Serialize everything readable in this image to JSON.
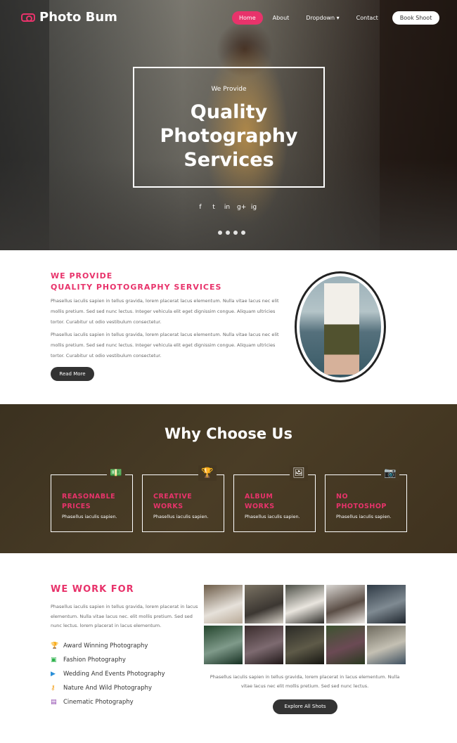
{
  "header": {
    "logo": "Photo Bum",
    "nav": [
      "Home",
      "About",
      "Dropdown ▾",
      "Contact"
    ],
    "book": "Book Shoot"
  },
  "hero": {
    "pre": "We Provide",
    "line1": "Quality",
    "line2": "Photography",
    "line3": "Services",
    "social": [
      "f",
      "t",
      "in",
      "g+",
      "ig"
    ]
  },
  "provide": {
    "title1": "WE PROVIDE",
    "title2": "QUALITY PHOTOGRAPHY SERVICES",
    "p1": "Phasellus iaculis sapien in tellus gravida, lorem placerat lacus elementum. Nulla vitae lacus nec elit mollis pretium. Sed sed nunc lectus. Integer vehicula elit eget dignissim congue. Aliquam ultricies tortor. Curabitur ut odio vestibulum consectetur.",
    "p2": "Phasellus iaculis sapien in tellus gravida, lorem placerat lacus elementum. Nulla vitae lacus nec elit mollis pretium. Sed sed nunc lectus. Integer vehicula elit eget dignissim congue. Aliquam ultricies tortor. Curabitur ut odio vestibulum consectetur.",
    "button": "Read More"
  },
  "why": {
    "title": "Why Choose Us",
    "cards": [
      {
        "t1": "REASONABLE",
        "t2": "PRICES",
        "d": "Phasellus iaculis sapien.",
        "icon": "💵"
      },
      {
        "t1": "CREATIVE",
        "t2": "WORKS",
        "d": "Phasellus iaculis sapien.",
        "icon": "🏆"
      },
      {
        "t1": "ALBUM",
        "t2": "WORKS",
        "d": "Phasellus iaculis sapien.",
        "icon": "🖼"
      },
      {
        "t1": "NO",
        "t2": "PHOTOSHOP",
        "d": "Phasellus iaculis sapien.",
        "icon": "📷"
      }
    ]
  },
  "work": {
    "title": "WE WORK FOR",
    "p": "Phasellus iaculis sapien in tellus gravida, lorem placerat in lacus elementum. Nulla vitae lacus nec. elit mollis pretium. Sed sed nunc lectus. lorem placerat in lacus elementum.",
    "items": [
      "Award Winning Photography",
      "Fashion Photography",
      "Wedding And Events Photography",
      "Nature And Wild Photography",
      "Cinematic Photography"
    ],
    "caption": "Phasellus iaculis sapien in tellus gravida, lorem placerat in lacus elementum. Nulla vitae lacus nec elit mollis pretium. Sed sed nunc lectus.",
    "button": "Explore All Shots"
  }
}
